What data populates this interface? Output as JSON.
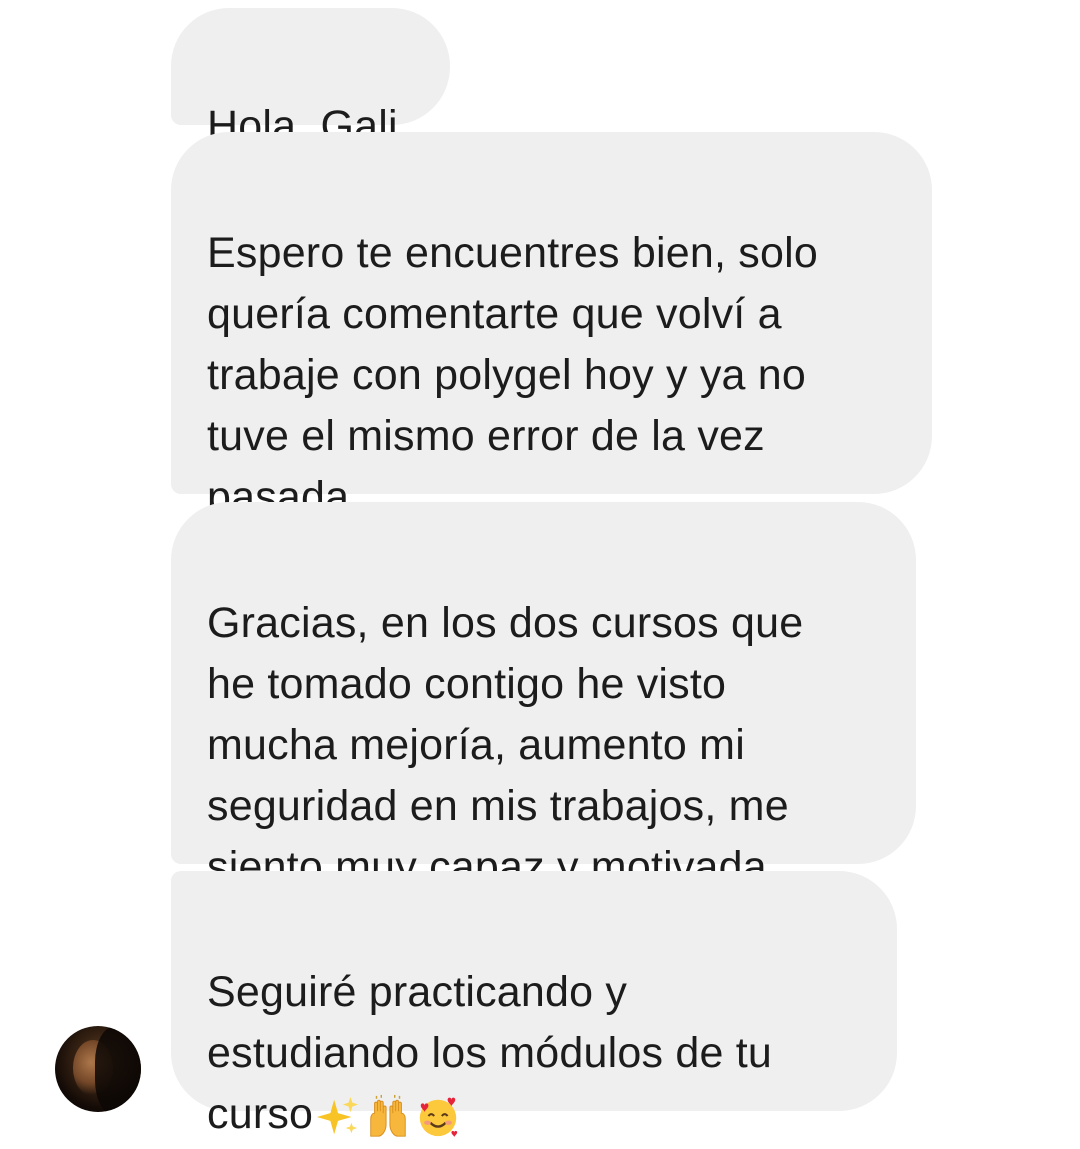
{
  "messages": [
    {
      "text": "Hola, Gali"
    },
    {
      "text": "Espero te encuentres bien, solo\nquería comentarte que volví a\ntrabaje con polygel hoy y ya no\ntuve el mismo error de la vez\npasada"
    },
    {
      "text": "Gracias, en los dos cursos que\nhe tomado contigo he visto\nmucha mejoría, aumento mi\nseguridad en mis trabajos, me\nsiento muy capaz y motivada"
    },
    {
      "text": "Seguiré practicando y\nestudiando los módulos de tu\ncurso",
      "emojis": [
        "sparkles-emoji",
        "raising-hands-emoji",
        "smiling-face-with-hearts-emoji"
      ]
    }
  ],
  "colors": {
    "bubble_background": "#efefef",
    "text": "#1c1c1c",
    "page_background": "#ffffff"
  },
  "sender": {
    "avatar": "profile-photo"
  }
}
